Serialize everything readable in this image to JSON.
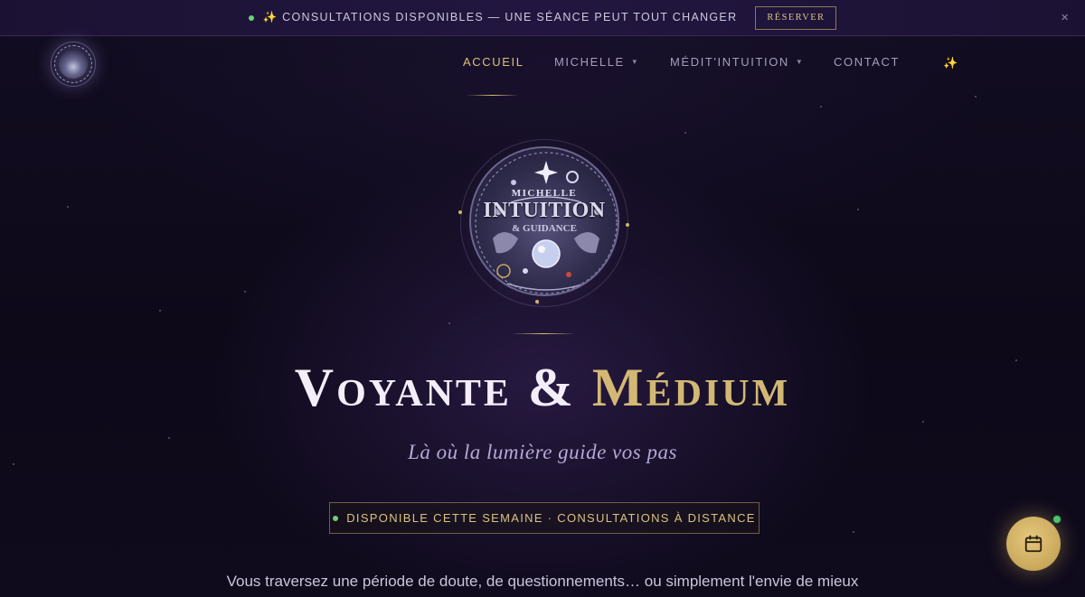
{
  "announcement": {
    "status_dot_color": "#6fcf7a",
    "icon": "sparkles-icon",
    "message": "✨ CONSULTATIONS DISPONIBLES — UNE SÉANCE PEUT TOUT CHANGER",
    "cta_label": "RÉSERVER",
    "close_icon": "close-icon",
    "close_glyph": "×"
  },
  "nav": {
    "items": [
      {
        "label": "ACCUEIL",
        "active": true,
        "has_dropdown": false
      },
      {
        "label": "MICHELLE",
        "active": false,
        "has_dropdown": true
      },
      {
        "label": "MÉDIT'INTUITION",
        "active": false,
        "has_dropdown": true
      },
      {
        "label": "CONTACT",
        "active": false,
        "has_dropdown": false
      }
    ],
    "caret_glyph": "▼",
    "sparkle_glyph": "✨"
  },
  "emblem": {
    "line1": "MICHELLE",
    "line2": "INTUITION",
    "line3": "& GUIDANCE"
  },
  "hero": {
    "title_part1": "Voyante & ",
    "title_part2": "Médium",
    "tagline": "Là où la lumière guide vos pas",
    "availability": "DISPONIBLE CETTE SEMAINE · CONSULTATIONS À DISTANCE",
    "intro": "Vous traversez une période de doute, de questionnements… ou simplement l'envie de mieux"
  },
  "floating_button": {
    "icon": "calendar-icon",
    "badge_color": "#4fc36a"
  },
  "colors": {
    "background": "#0e0a1a",
    "accent_gold": "#d3b874",
    "nav_active": "#d8c17c",
    "tagline": "#b5a9d4"
  }
}
